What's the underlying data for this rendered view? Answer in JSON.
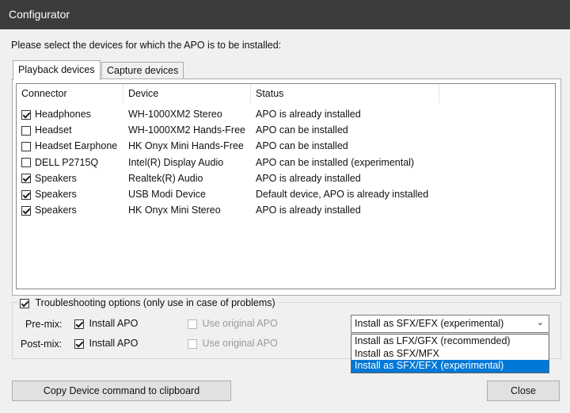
{
  "window": {
    "title": "Configurator"
  },
  "instruction": "Please select the devices for which the APO is to be installed:",
  "tabs": [
    {
      "label": "Playback devices",
      "active": true
    },
    {
      "label": "Capture devices",
      "active": false
    }
  ],
  "devices": {
    "columns": [
      "Connector",
      "Device",
      "Status"
    ],
    "rows": [
      {
        "checked": true,
        "connector": "Headphones",
        "device": "WH-1000XM2 Stereo",
        "status": "APO is already installed"
      },
      {
        "checked": false,
        "connector": "Headset",
        "device": "WH-1000XM2 Hands-Free",
        "status": "APO can be installed"
      },
      {
        "checked": false,
        "connector": "Headset Earphone",
        "device": "HK Onyx Mini Hands-Free",
        "status": "APO can be installed"
      },
      {
        "checked": false,
        "connector": "DELL P2715Q",
        "device": "Intel(R) Display Audio",
        "status": "APO can be installed (experimental)"
      },
      {
        "checked": true,
        "connector": "Speakers",
        "device": "Realtek(R) Audio",
        "status": "APO is already installed"
      },
      {
        "checked": true,
        "connector": "Speakers",
        "device": "USB Modi Device",
        "status": "Default device, APO is already installed"
      },
      {
        "checked": true,
        "connector": "Speakers",
        "device": "HK Onyx Mini Stereo",
        "status": "APO is already installed"
      }
    ]
  },
  "troubleshooting": {
    "label": "Troubleshooting options (only use in case of problems)",
    "checked": true,
    "premix": {
      "label": "Pre-mix:",
      "install_label": "Install APO",
      "install_checked": true,
      "original_label": "Use original APO",
      "original_checked": false
    },
    "postmix": {
      "label": "Post-mix:",
      "install_label": "Install APO",
      "install_checked": true,
      "original_label": "Use original APO",
      "original_checked": false
    },
    "install_mode": {
      "selected": "Install as SFX/EFX (experimental)",
      "options": [
        "Install as LFX/GFX (recommended)",
        "Install as SFX/MFX",
        "Install as SFX/EFX (experimental)"
      ],
      "highlighted_index": 2
    }
  },
  "buttons": {
    "copy": "Copy Device command to clipboard",
    "close": "Close"
  }
}
